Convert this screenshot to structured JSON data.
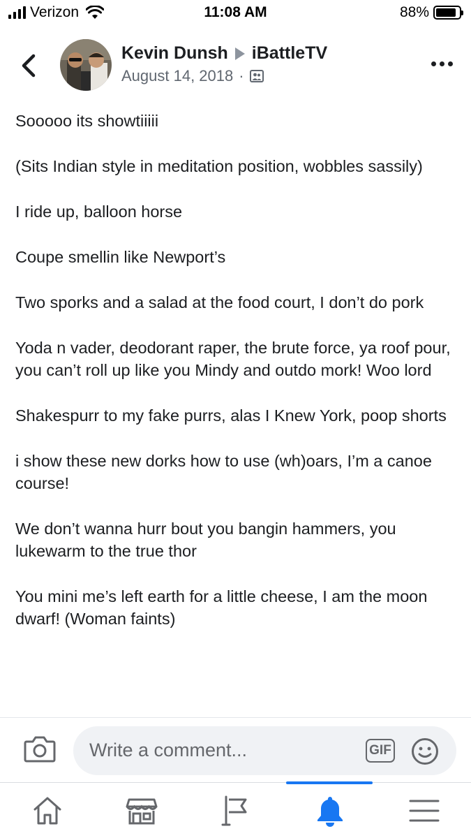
{
  "status_bar": {
    "carrier": "Verizon",
    "time": "11:08 AM",
    "battery": "88%",
    "battery_level": 0.88
  },
  "header": {
    "author": "Kevin Dunsh",
    "target": "iBattleTV",
    "date": "August 14, 2018",
    "separator": "·",
    "audience_icon": "group-audience-icon",
    "back_icon": "chevron-left-icon",
    "more_icon": "more-dots-icon"
  },
  "post": {
    "paragraphs": [
      "Sooooo its showtiiiii",
      "(Sits Indian style in meditation position, wobbles sassily)",
      "I ride up, balloon horse",
      "Coupe smellin like Newport’s",
      "Two sporks and a salad at the food court, I don’t do pork",
      "Yoda n vader, deodorant raper, the brute force, ya roof pour, you can’t roll up like you Mindy and outdo mork! Woo lord",
      "Shakespurr to my fake purrs, alas I Knew York, poop shorts",
      "i show these new dorks how to use (wh)oars, I’m a canoe course!",
      "We don’t wanna hurr bout you bangin hammers, you lukewarm to the true thor",
      "You mini me’s left earth for a little cheese, I am the moon dwarf! (Woman faints)"
    ]
  },
  "comment_bar": {
    "placeholder": "Write a comment...",
    "gif_label": "GIF",
    "camera_icon": "camera-icon",
    "emoji_icon": "emoji-icon"
  },
  "tab_bar": {
    "tabs": [
      {
        "icon": "home-icon"
      },
      {
        "icon": "marketplace-icon"
      },
      {
        "icon": "pages-flag-icon"
      },
      {
        "icon": "notifications-bell-icon",
        "active": true
      },
      {
        "icon": "menu-icon"
      }
    ]
  },
  "colors": {
    "accent": "#1877f2",
    "text": "#1c1e21",
    "secondary_text": "#606770",
    "input_bg": "#f0f2f5"
  }
}
